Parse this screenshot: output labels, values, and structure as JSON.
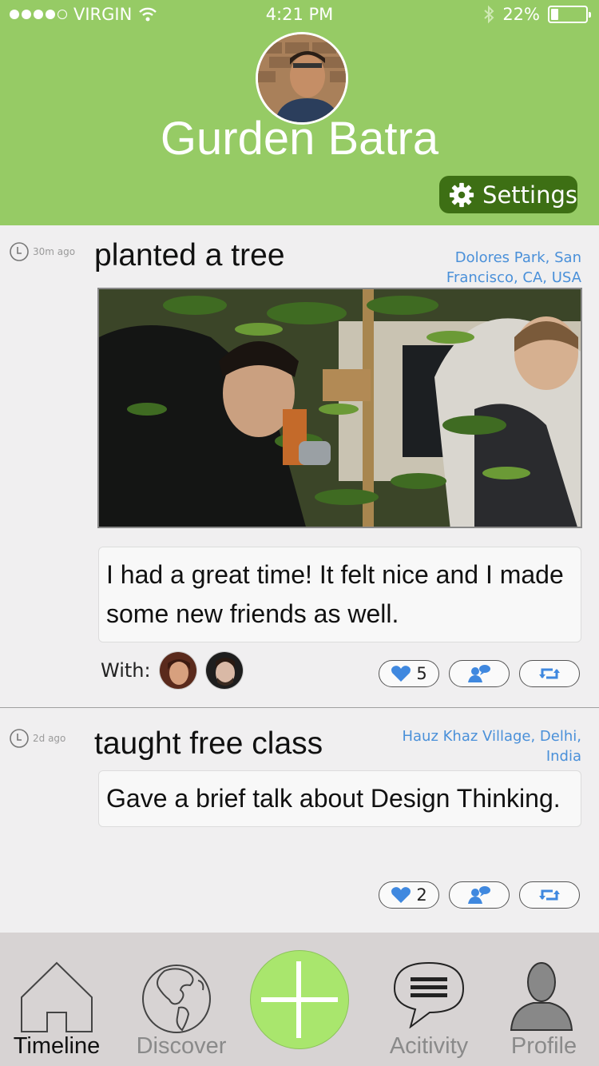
{
  "status": {
    "carrier": "VIRGIN",
    "time": "4:21 PM",
    "battery": "22%",
    "battery_level": 0.22
  },
  "profile": {
    "name": "Gurden Batra",
    "settings_label": "Settings"
  },
  "posts": [
    {
      "time": "30m ago",
      "activity": "planted a tree",
      "location_line1": "Dolores Park, San",
      "location_line2": "Francisco, CA, USA",
      "comment": "I had a great time! It felt nice and I made some new friends as well.",
      "with_label": "With:",
      "likes": "5"
    },
    {
      "time": "2d ago",
      "activity": "taught free class",
      "location_line1": "Hauz Khaz Village, Delhi,",
      "location_line2": "India",
      "comment": "Gave a brief talk about Design Thinking.",
      "likes": "2"
    }
  ],
  "nav": {
    "timeline": "Timeline",
    "discover": "Discover",
    "activity": "Acitivity",
    "profile": "Profile"
  },
  "colors": {
    "header": "#96cb65",
    "settings_bg": "#3d6f14",
    "link": "#4a90d9",
    "add_button": "#a9e66d",
    "nav_bg": "#d7d3d3"
  },
  "icons": [
    "wifi-icon",
    "bluetooth-icon",
    "gear-icon",
    "clock-icon",
    "heart-icon",
    "add-friend-icon",
    "retweet-icon",
    "home-icon",
    "globe-icon",
    "plus-icon",
    "chat-bubble-icon",
    "person-icon"
  ]
}
